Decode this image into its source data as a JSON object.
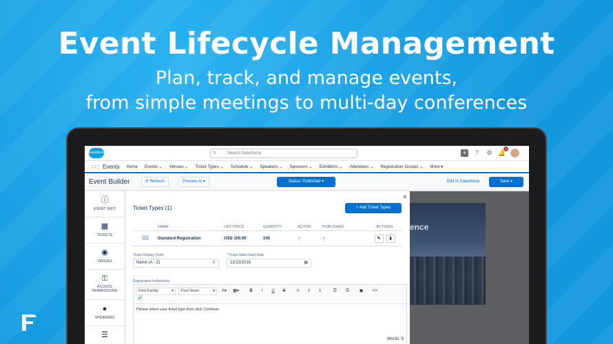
{
  "hero": {
    "title": "Event Lifecycle Management",
    "subtitle_line1": "Plan, track, and manage events,",
    "subtitle_line2": "from simple meetings to multi-day conferences"
  },
  "header": {
    "logo": "salesforce",
    "search_placeholder": "Search Salesforce",
    "notification_count": "3"
  },
  "nav": {
    "app_name": "Events",
    "items": [
      "Home",
      "Events",
      "Venues",
      "Ticket Types",
      "Schedule",
      "Speakers",
      "Sponsors",
      "Exhibitors",
      "Attendees",
      "Registration Groups",
      "More"
    ]
  },
  "toolbar": {
    "title": "Event Builder",
    "refresh": "Refresh",
    "preview": "Preview In",
    "status": "Status: Published",
    "edit_link": "Edit In Salesforce",
    "save": "Save"
  },
  "side_tabs": [
    {
      "label": "EVENT INFO",
      "icon": "info-icon"
    },
    {
      "label": "TICKETS",
      "icon": "ticket-icon"
    },
    {
      "label": "VENUES",
      "icon": "location-pin-icon"
    },
    {
      "label": "ACCESS PERMISSIONS",
      "icon": "key-icon"
    },
    {
      "label": "SPEAKERS",
      "icon": "person-icon"
    },
    {
      "label": "",
      "icon": "list-icon"
    }
  ],
  "panel": {
    "title": "Ticket Types (1)",
    "add_button": "+ Add Ticket Types",
    "columns": [
      "NAME",
      "LIST PRICE",
      "QUANTITY",
      "ACTIVE",
      "PUBLISHED",
      "ACTIONS"
    ],
    "rows": [
      {
        "name": "Standard Registration",
        "price": "USD 100.00",
        "quantity": "100",
        "active": "✓",
        "published": "✓"
      }
    ],
    "display_order_label": "Ticket Display Order",
    "display_order_value": "Name (A - Z)",
    "start_date_label": "* Ticket Sales Start Date",
    "start_date_value": "12/13/2016",
    "instructions_label": "Registration Instructions",
    "font_family": "Font Family",
    "font_sizes": "Font Sizes",
    "instructions_text": "Please select your ticket type then click Continue.",
    "words": "Words: 8"
  },
  "preview": {
    "banner_text": "ence"
  }
}
